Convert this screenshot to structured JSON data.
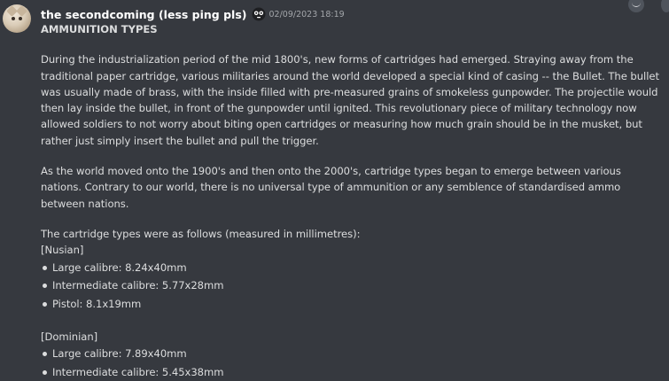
{
  "message": {
    "username": "the secondcoming (less ping pls)",
    "emoji": "face-with-spiral-eyes-icon",
    "timestamp": "02/09/2023 18:19",
    "title": "AMMUNITION TYPES",
    "paragraphs": [
      "During the industrialization period of the mid 1800's, new forms of cartridges had emerged. Straying away from the traditional paper cartridge, various militaries around the world developed a special kind of casing -- the Bullet. The bullet was usually made of brass, with the inside filled with pre-measured grains of smokeless gunpowder. The projectile would then lay inside the bullet, in front of the gunpowder until ignited. This revolutionary piece of military technology now allowed soldiers to not worry about biting open cartridges or measuring how much grain should be in the musket, but rather just simply insert the bullet and pull the trigger.",
      "As the world moved onto the 1900's and then onto the 2000's, cartridge types began to emerge between various nations. Contrary to our world, there is no universal type of ammunition or any semblence of standardised ammo between nations.",
      "The cartridge types were as follows (measured in millimetres):"
    ],
    "sections": [
      {
        "heading": "[Nusian]",
        "items": [
          "Large calibre: 8.24x40mm",
          "Intermediate calibre: 5.77x28mm",
          "Pistol: 8.1x19mm"
        ]
      },
      {
        "heading": "[Dominian]",
        "items": [
          "Large calibre: 7.89x40mm",
          "Intermediate calibre: 5.45x38mm"
        ]
      }
    ]
  }
}
